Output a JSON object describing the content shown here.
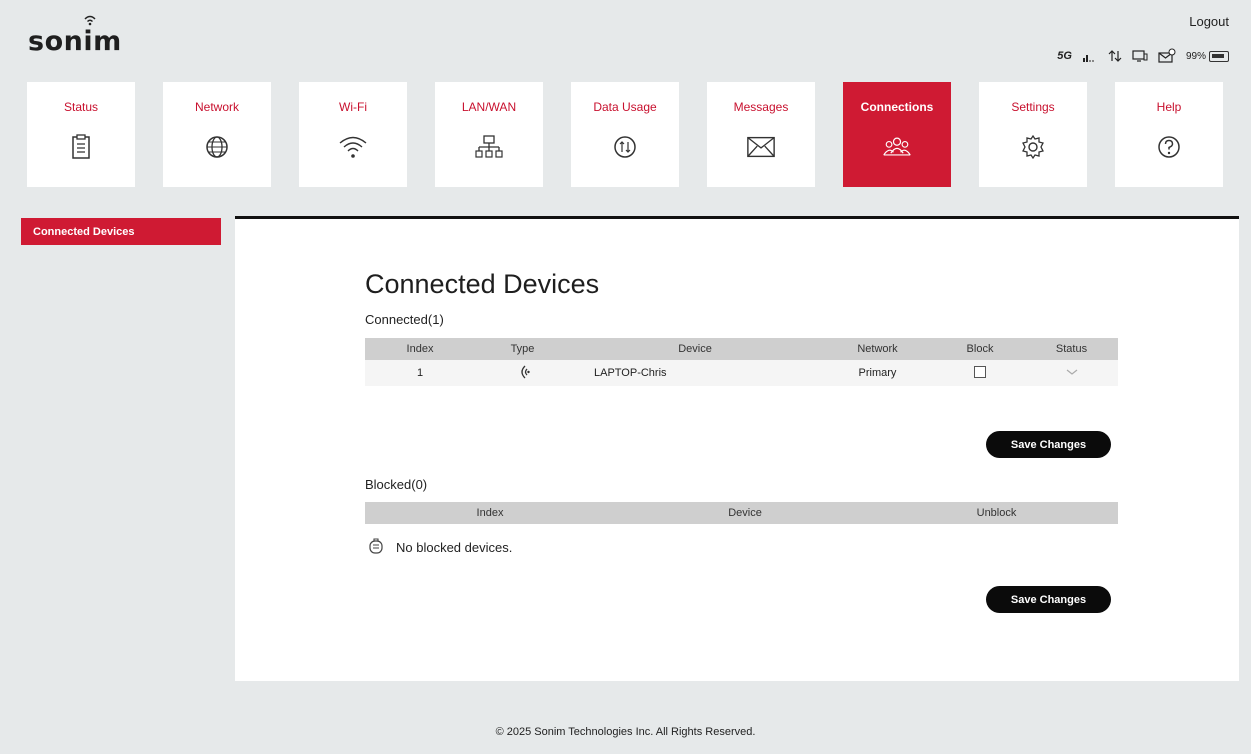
{
  "header": {
    "brand": "sonim",
    "logout_label": "Logout",
    "status": {
      "network_type": "5G",
      "battery_level": "99%",
      "icons": [
        "signal-icon",
        "data-transfer-icon",
        "connected-device-icon",
        "message-icon",
        "battery-icon"
      ]
    }
  },
  "nav": {
    "items": [
      {
        "label": "Status",
        "icon": "status-clipboard-icon"
      },
      {
        "label": "Network",
        "icon": "globe-icon"
      },
      {
        "label": "Wi-Fi",
        "icon": "wifi-icon"
      },
      {
        "label": "LAN/WAN",
        "icon": "network-tree-icon"
      },
      {
        "label": "Data Usage",
        "icon": "data-usage-icon"
      },
      {
        "label": "Messages",
        "icon": "envelope-icon"
      },
      {
        "label": "Connections",
        "icon": "users-icon"
      },
      {
        "label": "Settings",
        "icon": "gear-icon"
      },
      {
        "label": "Help",
        "icon": "help-icon"
      }
    ],
    "active": "Connections"
  },
  "sidebar": {
    "items": [
      {
        "label": "Connected Devices"
      }
    ]
  },
  "main": {
    "title": "Connected Devices",
    "connected": {
      "heading": "Connected(1)",
      "columns": [
        "Index",
        "Type",
        "Device",
        "Network",
        "Block",
        "Status"
      ],
      "rows": [
        {
          "index": "1",
          "type_icon": "wifi-device-icon",
          "device": "LAPTOP-Chris",
          "network": "Primary",
          "block": false,
          "status_icon": "chevron-down-icon"
        }
      ],
      "save_label": "Save Changes"
    },
    "blocked": {
      "heading": "Blocked(0)",
      "columns": [
        "Index",
        "Device",
        "Unblock"
      ],
      "empty_text": "No blocked devices.",
      "save_label": "Save Changes"
    }
  },
  "footer": {
    "copyright": "© 2025 Sonim Technologies Inc. All Rights Reserved."
  },
  "colors": {
    "accent": "#cf1a33",
    "button": "#0b0b0b",
    "background": "#e6e9ea"
  }
}
